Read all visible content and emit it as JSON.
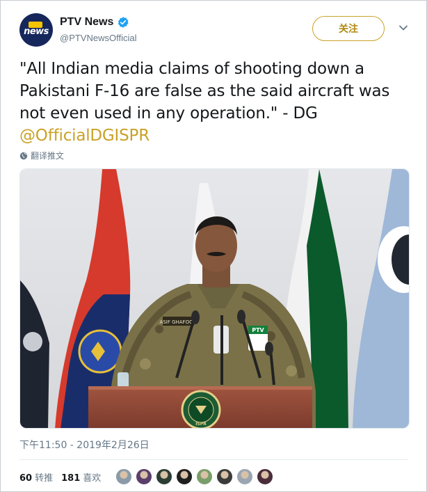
{
  "account": {
    "display_name": "PTV News",
    "handle": "@PTVNewsOfficial",
    "avatar_logo_top": "PTV",
    "avatar_logo_word": "news",
    "verified": true
  },
  "actions": {
    "follow_label": "关注"
  },
  "tweet": {
    "text": "\"All Indian media claims of shooting down a Pakistani F-16 are false as the said aircraft was not even used in any operation.\" - DG ",
    "mention": "@OfficialDGISPR",
    "translate_label": "翻译推文",
    "timestamp": "下午11:50 - 2019年2月26日"
  },
  "media": {
    "desk_badge_text": "ISPR",
    "name_tag": "ASIF GHAFOOR",
    "mic_label": "PTV"
  },
  "stats": {
    "retweets_count": "60",
    "retweets_label": "转推",
    "likes_count": "181",
    "likes_label": "喜欢"
  },
  "likers": [
    "#8a9aa8",
    "#5a3f6b",
    "#2c3d33",
    "#1f1f1f",
    "#7a9e6a",
    "#3b3b3b",
    "#9aa6b2",
    "#4a2d3a"
  ],
  "colors": {
    "mention": "#c9a227",
    "follow_border": "#c9a227",
    "verified": "#1da1f2",
    "secondary_text": "#657786"
  }
}
